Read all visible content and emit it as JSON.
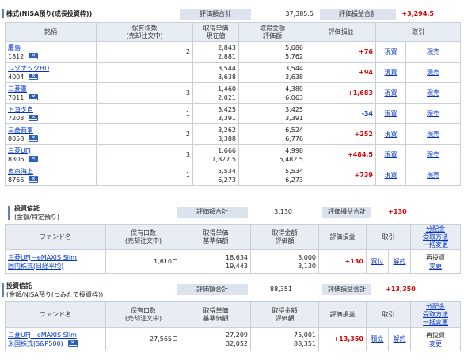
{
  "stocks": {
    "title": "株式(NISA預り(成長投資枠))",
    "eval_total_label": "評価額合計",
    "eval_total": "37,385.5",
    "pl_total_label": "評価損益合計",
    "pl_total": "+3,294.5",
    "headers": [
      "銘柄",
      "保有株数\n(売却注文中)",
      "取得単価\n現在値",
      "取得金額\n評価額",
      "評価損益",
      "取引"
    ],
    "rows": [
      {
        "name": "慶島",
        "code": "1812",
        "qty": "2",
        "cost": "2,843",
        "price": "2,881",
        "buy_amt": "5,686",
        "eval_amt": "5,762",
        "pl": "+76",
        "pl_sign": "pos"
      },
      {
        "name": "レゾナックHD",
        "code": "4004",
        "qty": "1",
        "cost": "3,544",
        "price": "3,638",
        "buy_amt": "3,544",
        "eval_amt": "3,638",
        "pl": "+94",
        "pl_sign": "pos"
      },
      {
        "name": "三菱重",
        "code": "7011",
        "qty": "3",
        "cost": "1,460",
        "price": "2,021",
        "buy_amt": "4,380",
        "eval_amt": "6,063",
        "pl": "+1,683",
        "pl_sign": "pos"
      },
      {
        "name": "トヨタ自",
        "code": "7203",
        "qty": "1",
        "cost": "3,425",
        "price": "3,391",
        "buy_amt": "3,425",
        "eval_amt": "3,391",
        "pl": "-34",
        "pl_sign": "neg"
      },
      {
        "name": "三菱商事",
        "code": "8058",
        "qty": "2",
        "cost": "3,262",
        "price": "3,388",
        "buy_amt": "6,524",
        "eval_amt": "6,776",
        "pl": "+252",
        "pl_sign": "pos"
      },
      {
        "name": "三菱UFJ",
        "code": "8306",
        "qty": "3",
        "cost": "1,666",
        "price": "1,827.5",
        "buy_amt": "4,998",
        "eval_amt": "5,482.5",
        "pl": "+484.5",
        "pl_sign": "pos"
      },
      {
        "name": "東京海上",
        "code": "8766",
        "qty": "1",
        "cost": "5,534",
        "price": "6,273",
        "buy_amt": "5,534",
        "eval_amt": "6,273",
        "pl": "+739",
        "pl_sign": "pos"
      }
    ],
    "buy_link": "現買",
    "sell_link": "現売"
  },
  "fund1": {
    "title": "投資信託",
    "subtitle": "(金額/特定預り)",
    "eval_total_label": "評価額合計",
    "eval_total": "3,130",
    "pl_total_label": "評価損益合計",
    "pl_total": "+130",
    "headers": [
      "ファンド名",
      "保有口数\n(売却注文中)",
      "取得単価\n基準価額",
      "取得金額\n評価額",
      "評価損益",
      "取引",
      "分配金\n受取方法\n一括変更"
    ],
    "row": {
      "name1": "三菱UFJ－eMAXIS Slim",
      "name2": "国内株式(日経平均)",
      "qty": "1,610口",
      "cost": "18,634",
      "nav": "19,443",
      "buy_amt": "3,000",
      "eval_amt": "3,130",
      "pl": "+130",
      "buy": "買付",
      "sell": "解約",
      "dist1": "再投資",
      "dist2": "変更"
    }
  },
  "fund2": {
    "title": "投資信託",
    "subtitle": "(金額/NISA預り(つみたて投資枠))",
    "eval_total_label": "評価額合計",
    "eval_total": "88,351",
    "pl_total_label": "評価損益合計",
    "pl_total": "+13,350",
    "headers": [
      "ファンド名",
      "保有口数\n(売却注文中)",
      "取得単価\n基準価額",
      "取得金額\n評価額",
      "評価損益",
      "取引",
      "分配金\n受取方法\n一括変更"
    ],
    "row": {
      "name1": "三菱UFJ－eMAXIS Slim",
      "name2": "米国株式(S&P500)",
      "qty": "27,565口",
      "cost": "27,209",
      "nav": "32,052",
      "buy_amt": "75,001",
      "eval_amt": "88,351",
      "pl": "+13,350",
      "buy": "積立",
      "sell": "解約",
      "dist1": "再投資",
      "dist2": "変更"
    }
  },
  "colors": {
    "positive": "#e00000",
    "negative": "#0033cc",
    "header_bg": "#dde3ee"
  }
}
